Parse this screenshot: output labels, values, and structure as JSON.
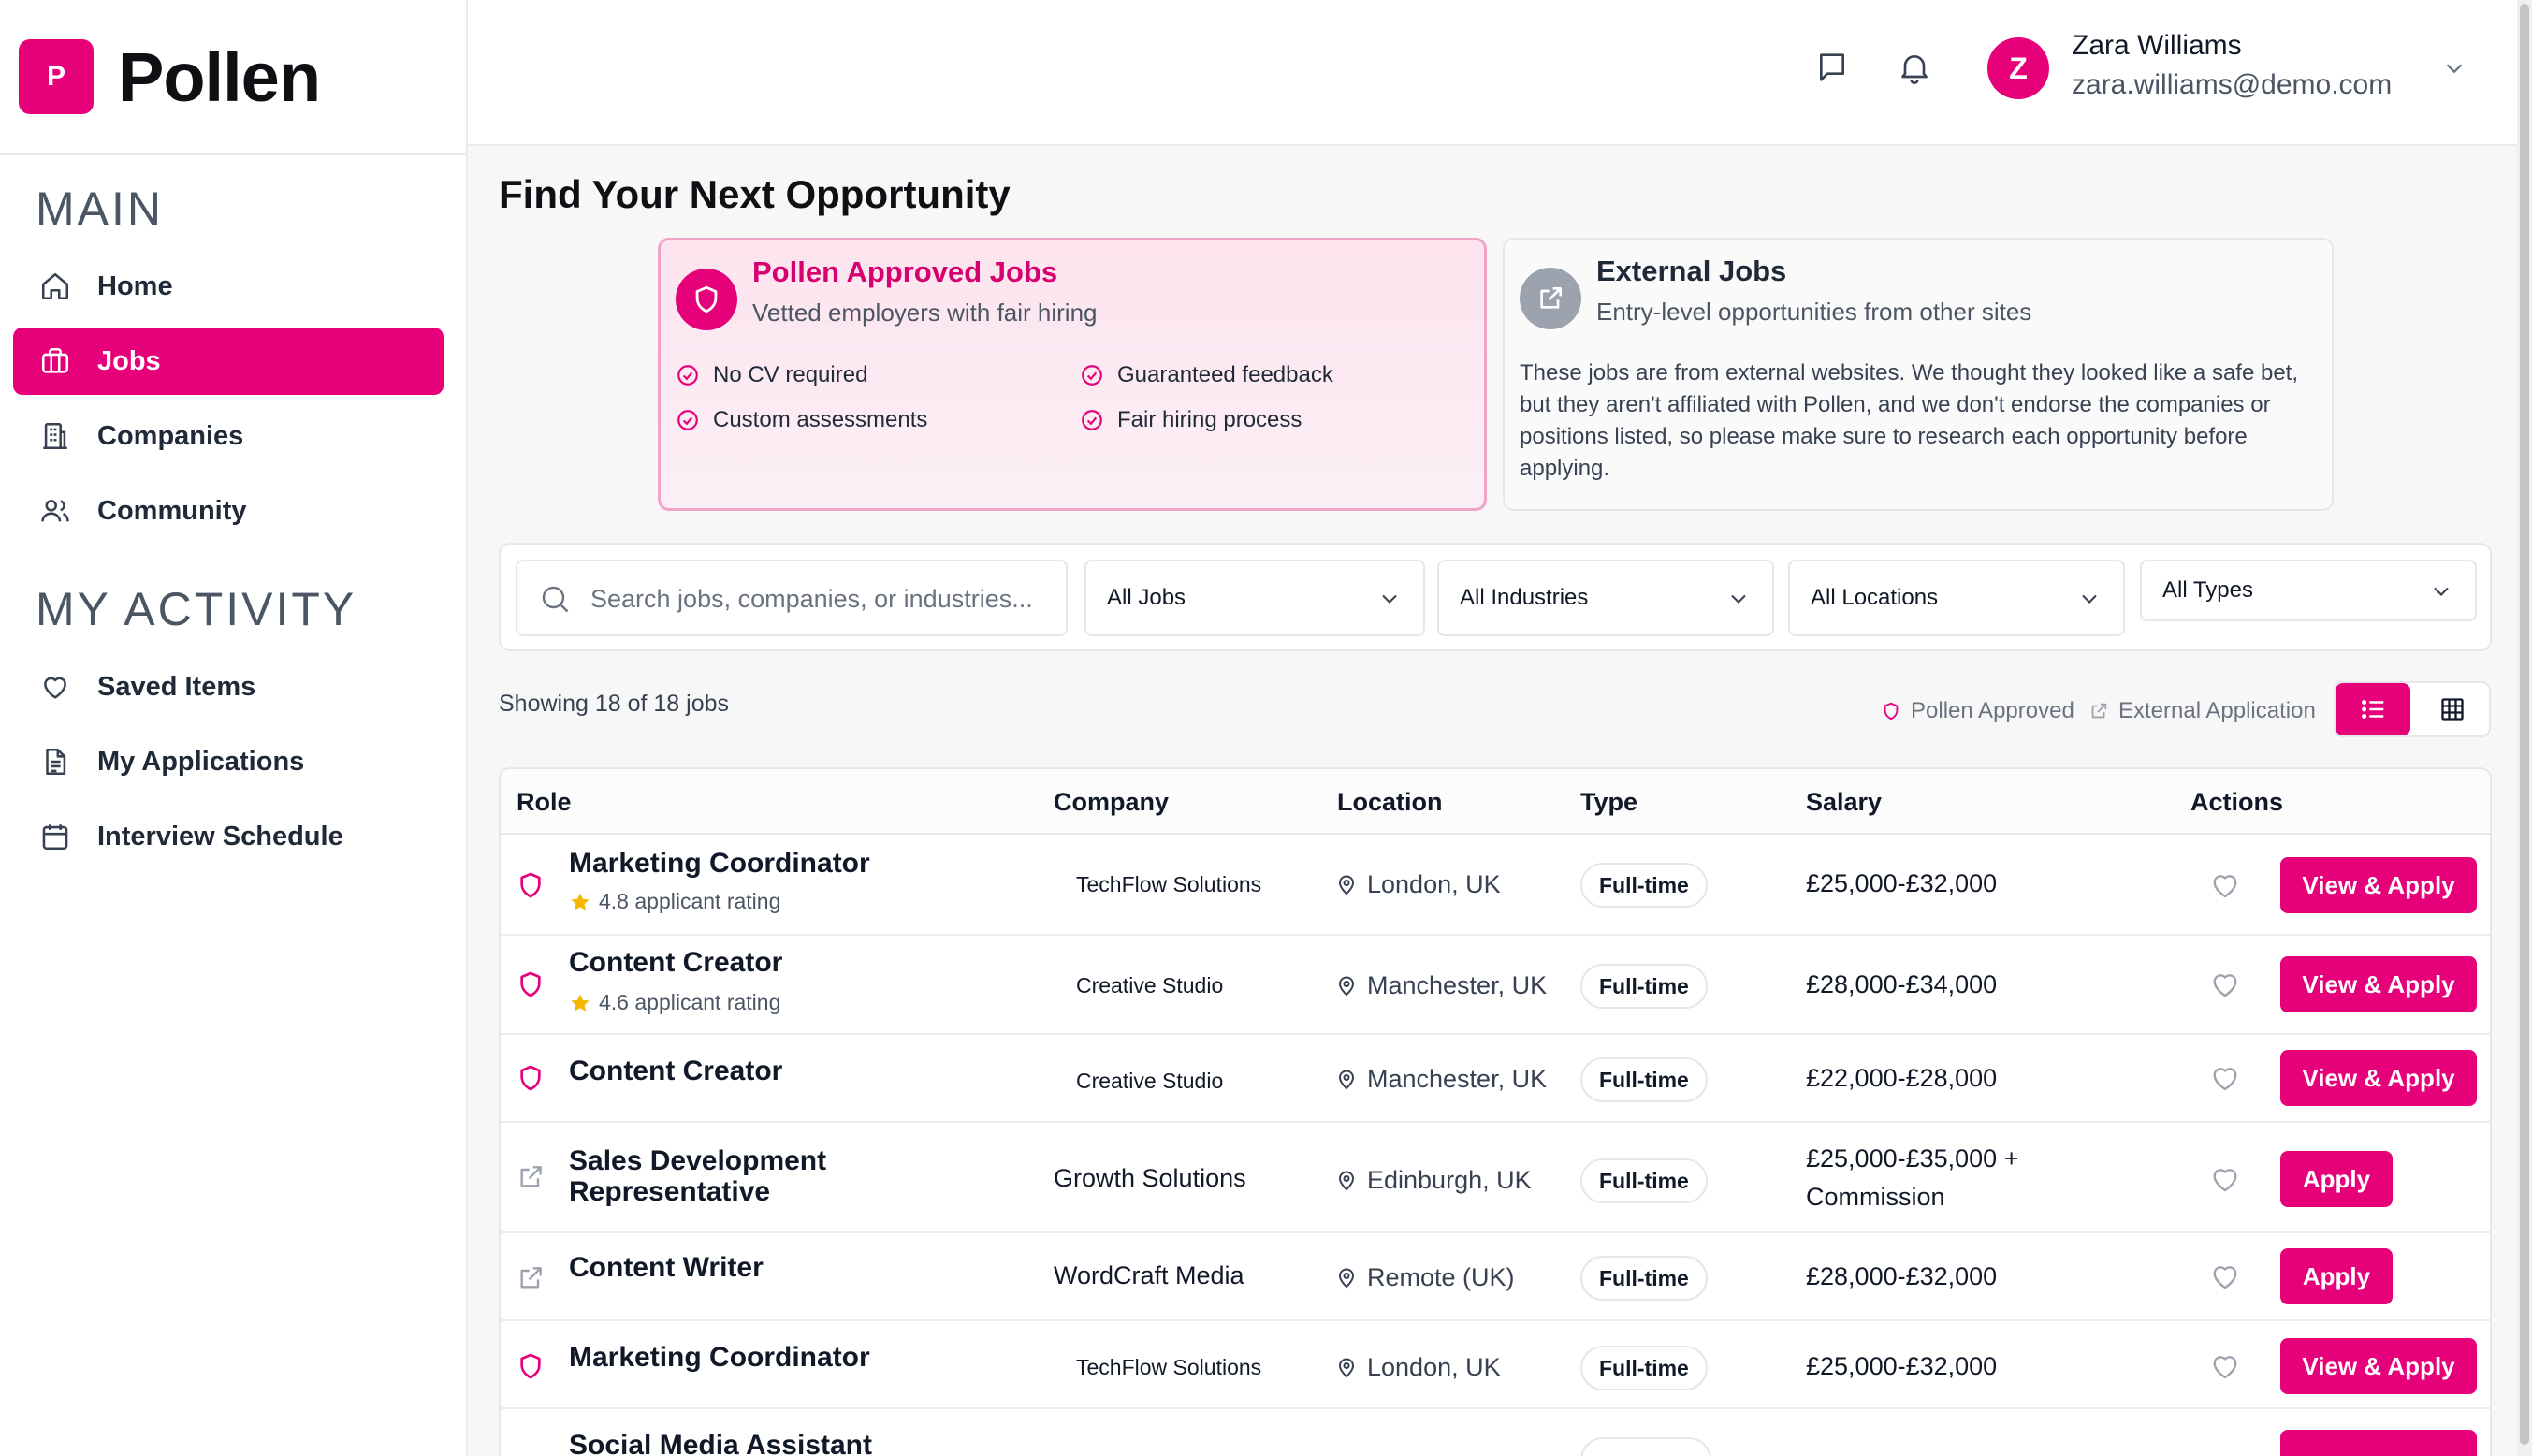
{
  "brand": {
    "logo_letter": "P",
    "name": "Pollen",
    "accent": "#e6007a"
  },
  "sidebar": {
    "main_title": "MAIN",
    "main_items": [
      {
        "label": "Home",
        "icon": "home-icon"
      },
      {
        "label": "Jobs",
        "icon": "briefcase-icon",
        "active": true
      },
      {
        "label": "Companies",
        "icon": "building-icon"
      },
      {
        "label": "Community",
        "icon": "users-icon"
      }
    ],
    "activity_title": "MY ACTIVITY",
    "activity_items": [
      {
        "label": "Saved Items",
        "icon": "heart-icon"
      },
      {
        "label": "My Applications",
        "icon": "document-icon"
      },
      {
        "label": "Interview Schedule",
        "icon": "calendar-icon"
      }
    ]
  },
  "header": {
    "user": {
      "initial": "Z",
      "name": "Zara Williams",
      "email": "zara.williams@demo.com"
    }
  },
  "page": {
    "title": "Find Your Next Opportunity"
  },
  "cards": {
    "approved": {
      "title": "Pollen Approved Jobs",
      "subtitle": "Vetted employers with fair hiring",
      "features": [
        "No CV required",
        "Guaranteed feedback",
        "Custom assessments",
        "Fair hiring process"
      ]
    },
    "external": {
      "title": "External Jobs",
      "subtitle": "Entry-level opportunities from other sites",
      "description": "These jobs are from external websites. We thought they looked like a safe bet, but they aren't affiliated with Pollen, and we don't endorse the companies or positions listed, so please make sure to research each opportunity before applying."
    }
  },
  "filters": {
    "search_placeholder": "Search jobs, companies, or industries...",
    "search_value": "",
    "jobs": "All Jobs",
    "industries": "All Industries",
    "locations": "All Locations",
    "types": "All Types"
  },
  "results": {
    "showing": "Showing 18 of 18 jobs",
    "legend_approved": "Pollen Approved",
    "legend_external": "External Application"
  },
  "table": {
    "headers": {
      "role": "Role",
      "company": "Company",
      "location": "Location",
      "type": "Type",
      "salary": "Salary",
      "actions": "Actions"
    },
    "rows": [
      {
        "approved": true,
        "role": "Marketing Coordinator",
        "rating": "4.8 applicant rating",
        "company": "TechFlow Solutions",
        "location": "London, UK",
        "type": "Full-time",
        "salary": "£25,000-£32,000",
        "action": "View & Apply"
      },
      {
        "approved": true,
        "role": "Content Creator",
        "rating": "4.6 applicant rating",
        "company": "Creative Studio",
        "location": "Manchester, UK",
        "type": "Full-time",
        "salary": "£28,000-£34,000",
        "action": "View & Apply"
      },
      {
        "approved": true,
        "role": "Content Creator",
        "rating": "",
        "company": "Creative Studio",
        "location": "Manchester, UK",
        "type": "Full-time",
        "salary": "£22,000-£28,000",
        "action": "View & Apply"
      },
      {
        "approved": false,
        "role": "Sales Development Representative",
        "rating": "",
        "company": "Growth Solutions",
        "location": "Edinburgh, UK",
        "type": "Full-time",
        "salary": "£25,000-£35,000 + Commission",
        "action": "Apply"
      },
      {
        "approved": false,
        "role": "Content Writer",
        "rating": "",
        "company": "WordCraft Media",
        "location": "Remote (UK)",
        "type": "Full-time",
        "salary": "£28,000-£32,000",
        "action": "Apply"
      },
      {
        "approved": true,
        "role": "Marketing Coordinator",
        "rating": "",
        "company": "TechFlow Solutions",
        "location": "London, UK",
        "type": "Full-time",
        "salary": "£25,000-£32,000",
        "action": "View & Apply"
      },
      {
        "approved": true,
        "role": "Social Media Assistant",
        "rating": "",
        "company": "",
        "location": "",
        "type": "",
        "salary": "",
        "action": ""
      }
    ]
  }
}
